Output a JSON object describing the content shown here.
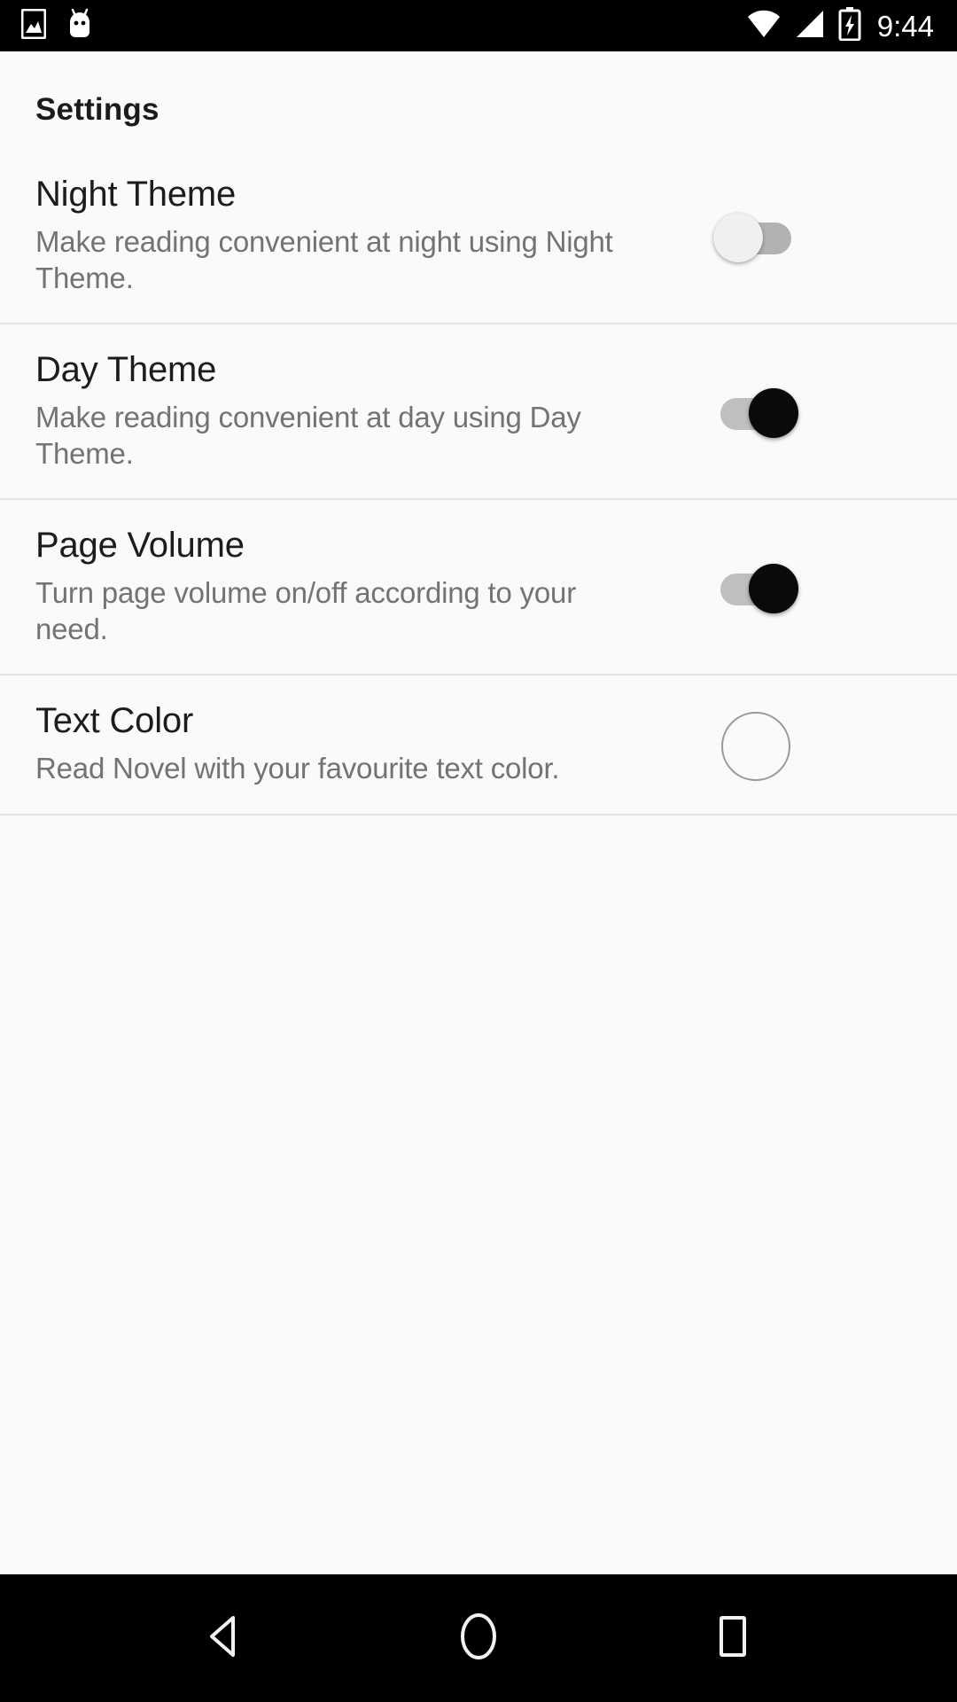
{
  "status_bar": {
    "time": "9:44",
    "icons": {
      "photo": "photo-icon",
      "android": "android-mascot-icon",
      "wifi": "wifi-icon",
      "signal": "cellular-signal-icon",
      "battery": "battery-charging-icon"
    },
    "background_color": "#000000",
    "foreground_color": "#ffffff"
  },
  "screen": {
    "title": "Settings",
    "background_color": "#fafafa",
    "title_color": "#1b1b1b",
    "subtitle_color": "#737373",
    "divider_color": "#e4e4e4"
  },
  "settings": [
    {
      "key": "night-theme",
      "title": "Night Theme",
      "subtitle": "Make reading convenient at night using Night Theme.",
      "control": "switch",
      "state": "off",
      "track_color": "#b2b2b2",
      "thumb_color": "#f0f0f0"
    },
    {
      "key": "day-theme",
      "title": "Day Theme",
      "subtitle": "Make reading convenient at day using Day Theme.",
      "control": "switch",
      "state": "on",
      "track_color": "#bfbfbf",
      "thumb_color": "#0a0a0a"
    },
    {
      "key": "page-volume",
      "title": "Page Volume",
      "subtitle": "Turn page volume on/off according to your need.",
      "control": "switch",
      "state": "on",
      "track_color": "#bfbfbf",
      "thumb_color": "#0a0a0a"
    },
    {
      "key": "text-color",
      "title": "Text Color",
      "subtitle": "Read Novel with your favourite text color.",
      "control": "color-swatch",
      "state": "",
      "swatch_color": "#000000"
    }
  ],
  "nav_bar": {
    "background_color": "#000000",
    "buttons": [
      {
        "key": "back",
        "icon": "back-triangle-icon"
      },
      {
        "key": "home",
        "icon": "home-circle-icon"
      },
      {
        "key": "recents",
        "icon": "recents-square-icon"
      }
    ]
  }
}
